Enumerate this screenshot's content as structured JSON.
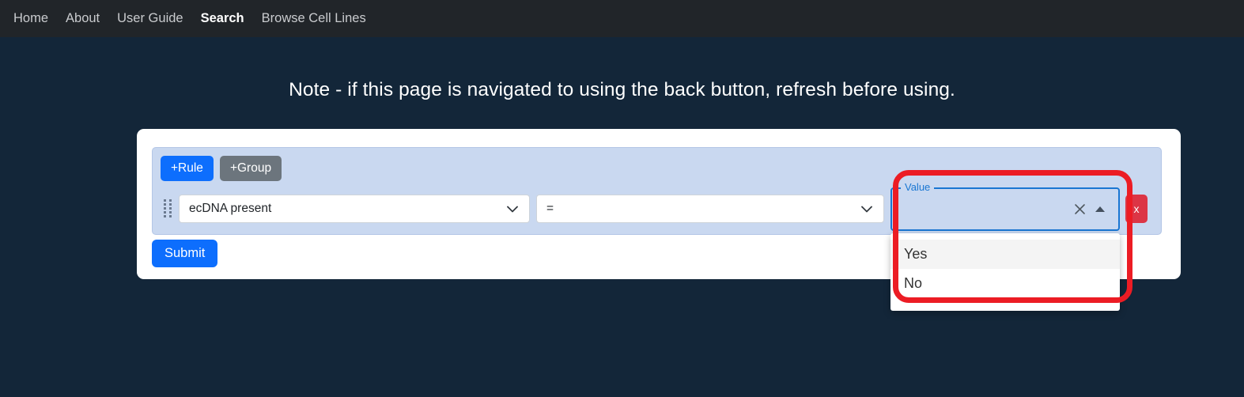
{
  "navbar": {
    "items": [
      {
        "label": "Home",
        "active": false
      },
      {
        "label": "About",
        "active": false
      },
      {
        "label": "User Guide",
        "active": false
      },
      {
        "label": "Search",
        "active": true
      },
      {
        "label": "Browse Cell Lines",
        "active": false
      }
    ]
  },
  "note": {
    "text": "Note - if this page is navigated to using the back button, refresh before using."
  },
  "query_builder": {
    "add_rule_label": "+Rule",
    "add_group_label": "+Group",
    "rule": {
      "field_value": "ecDNA present",
      "operator_value": "=",
      "value_label": "Value",
      "value_text": "",
      "clear_icon": "close-icon",
      "toggle_icon": "chevron-up-icon",
      "delete_label": "x",
      "drag_handle_icon": "drag-handle-icon"
    },
    "value_options": [
      {
        "label": "Yes",
        "hovered": true
      },
      {
        "label": "No",
        "hovered": false
      }
    ]
  },
  "submit": {
    "label": "Submit"
  },
  "colors": {
    "page_background": "#132639",
    "navbar_background": "#212529",
    "card_background": "#ffffff",
    "group_panel_background": "#c9d8f0",
    "primary": "#0d6efd",
    "secondary": "#6c757d",
    "danger": "#dc3545",
    "mui_accent": "#1976d2",
    "annotation": "#ec1c24"
  }
}
